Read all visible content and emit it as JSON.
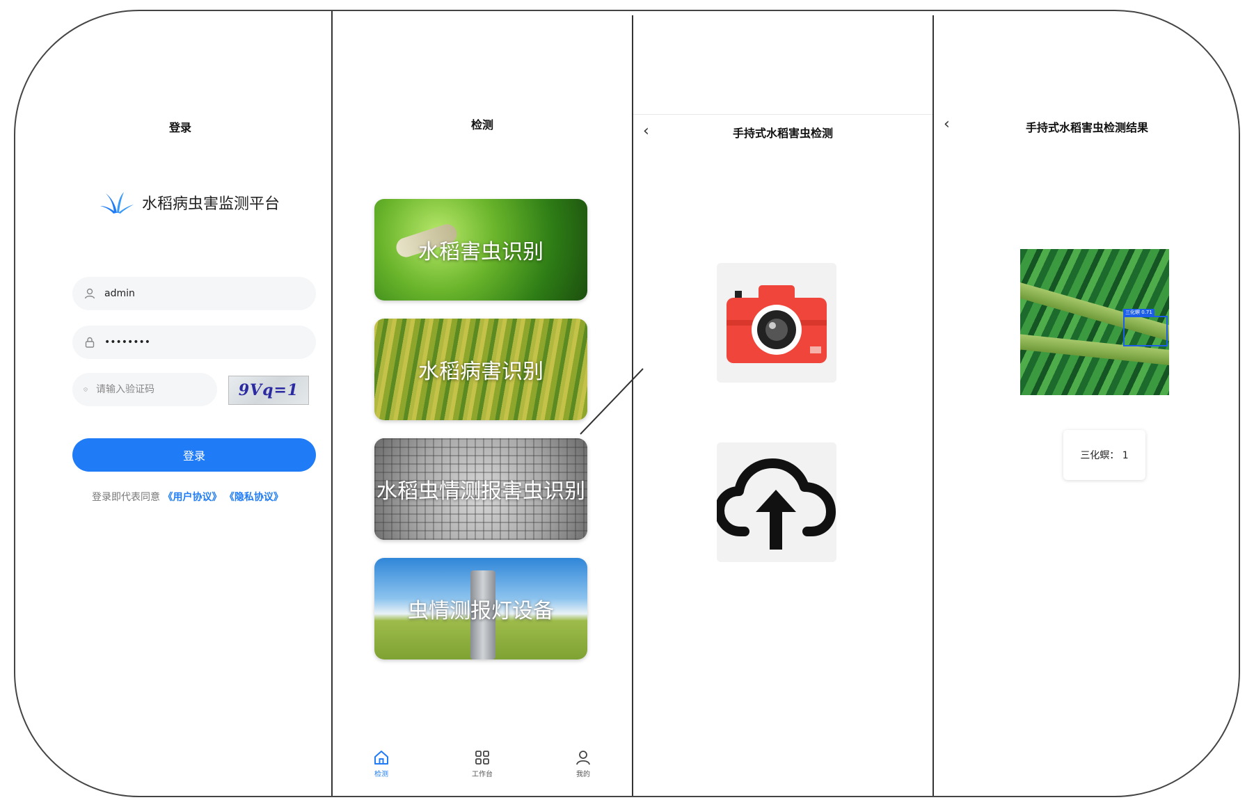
{
  "login": {
    "title": "登录",
    "app_name": "水稻病虫害监测平台",
    "username_value": "admin",
    "password_value": "••••••••",
    "captcha_placeholder": "请输入验证码",
    "captcha_text": "9Vq=1",
    "login_button": "登录",
    "agree_prefix": "登录即代表同意",
    "user_agreement": "《用户协议》",
    "privacy_agreement": "《隐私协议》"
  },
  "detect": {
    "title": "检测",
    "cards": [
      {
        "label": "水稻害虫识别"
      },
      {
        "label": "水稻病害识别"
      },
      {
        "label": "水稻虫情测报害虫识别"
      },
      {
        "label": "虫情测报灯设备"
      }
    ],
    "tabs": [
      {
        "label": "检测",
        "icon": "home-icon",
        "active": true
      },
      {
        "label": "工作台",
        "icon": "grid-icon",
        "active": false
      },
      {
        "label": "我的",
        "icon": "user-icon",
        "active": false
      }
    ]
  },
  "handheld": {
    "title": "手持式水稻害虫检测",
    "camera_icon": "camera-icon",
    "upload_icon": "cloud-upload-icon"
  },
  "result": {
    "title": "手持式水稻害虫检测结果",
    "detection_tag": "三化螟 0.71",
    "summary": "三化螟：  1"
  },
  "colors": {
    "accent": "#1f7cf6",
    "camera_red": "#f0453a",
    "frame_border": "#444444"
  }
}
